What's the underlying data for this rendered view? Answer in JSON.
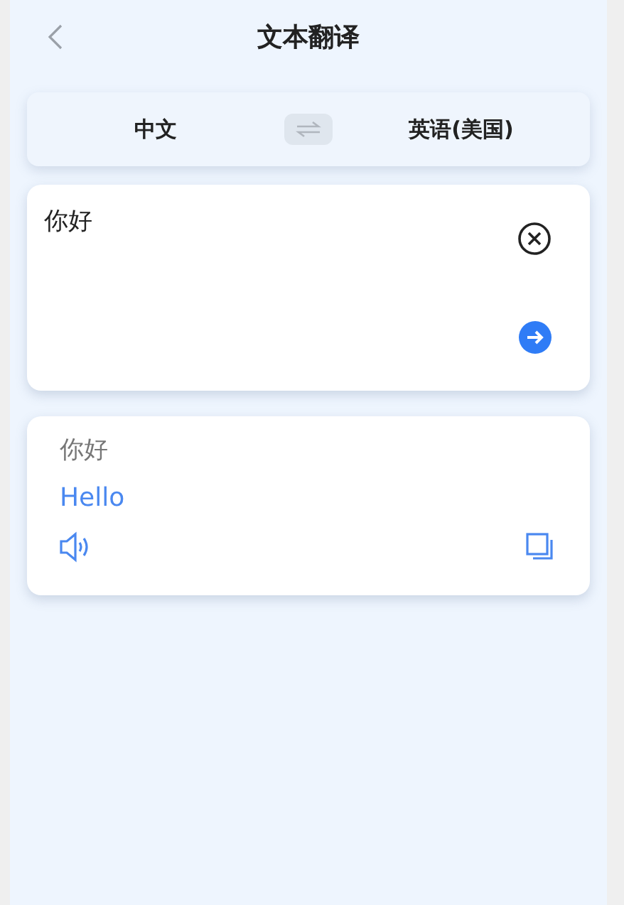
{
  "header": {
    "title": "文本翻译"
  },
  "languages": {
    "source": "中文",
    "target": "英语(美国)"
  },
  "input": {
    "value": "你好"
  },
  "result": {
    "source_text": "你好",
    "translation": "Hello"
  }
}
